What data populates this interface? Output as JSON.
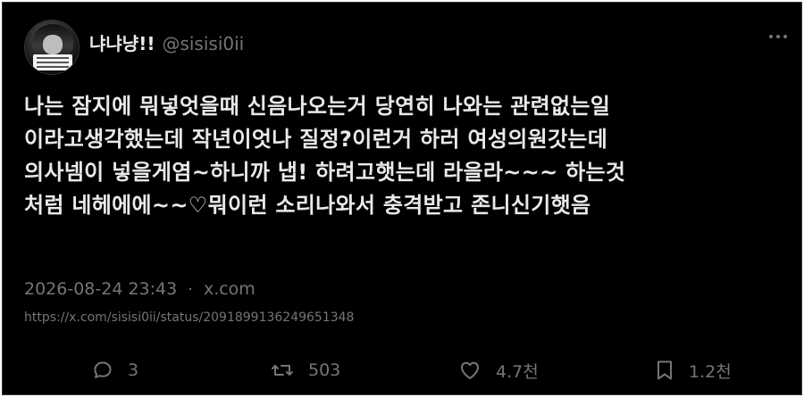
{
  "user": {
    "display_name": "냐냐냥!!",
    "handle": "@sisisi0ii"
  },
  "tweet": {
    "lines": [
      "나는 잠지에 뭐넣엇을때 신음나오는거 당연히 나와는 관련없는일",
      "이라고생각했는데 작년이엇나 질정?이런거 하러 여성의원갓는데",
      "의사넴이 넣을게염~하니까 냅! 하려고햇는데 라을라~~~ 하는것",
      "처럼 네헤에에~~♡뭐이런 소리나와서 충격받고 존니신기햇음"
    ],
    "timestamp": "2026-08-24 23:43",
    "separator": "·",
    "source": "x.com",
    "url": "https://x.com/sisisi0ii/status/2091899136249651348"
  },
  "stats": {
    "replies": "3",
    "reposts": "503",
    "likes": "4.7천",
    "bookmarks": "1.2천"
  },
  "icons": {
    "reply": "reply-icon",
    "repost": "repost-icon",
    "like": "heart-icon",
    "bookmark": "bookmark-icon",
    "more": "more-icon"
  },
  "colors": {
    "background": "#000000",
    "text": "#e7e9ea",
    "muted": "#71767b"
  }
}
